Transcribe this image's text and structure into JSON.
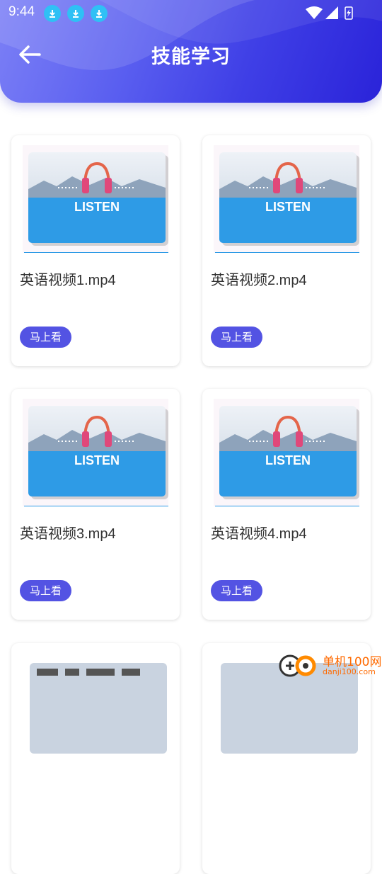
{
  "status_bar": {
    "time": "9:44"
  },
  "header": {
    "title": "技能学习"
  },
  "thumbnail": {
    "label": "LISTEN"
  },
  "cards": [
    {
      "title": "英语视频1.mp4",
      "button": "马上看"
    },
    {
      "title": "英语视频2.mp4",
      "button": "马上看"
    },
    {
      "title": "英语视频3.mp4",
      "button": "马上看"
    },
    {
      "title": "英语视频4.mp4",
      "button": "马上看"
    }
  ],
  "watermark": {
    "line1": "单机100网",
    "line2": "danji100.com"
  },
  "colors": {
    "accent": "#5353e3",
    "header_start": "#7c80f6",
    "header_end": "#2a23d9"
  }
}
